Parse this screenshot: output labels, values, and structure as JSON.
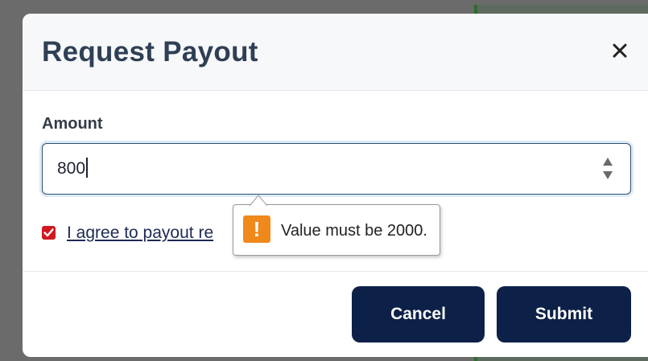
{
  "modal": {
    "title": "Request Payout",
    "close_icon": "close-icon"
  },
  "form": {
    "amount_label": "Amount",
    "amount_value": "800",
    "stepper_up_icon": "chevron-up-icon",
    "stepper_down_icon": "chevron-down-icon",
    "agree_checked": true,
    "agree_label": "I agree to payout re"
  },
  "validation_tooltip": {
    "icon": "warning-icon",
    "icon_glyph": "!",
    "message": "Value must be 2000."
  },
  "footer": {
    "cancel_label": "Cancel",
    "submit_label": "Submit"
  },
  "colors": {
    "primary_button": "#0d2148",
    "checkbox": "#d01820",
    "warning": "#f0891c",
    "title": "#2f3f55"
  }
}
